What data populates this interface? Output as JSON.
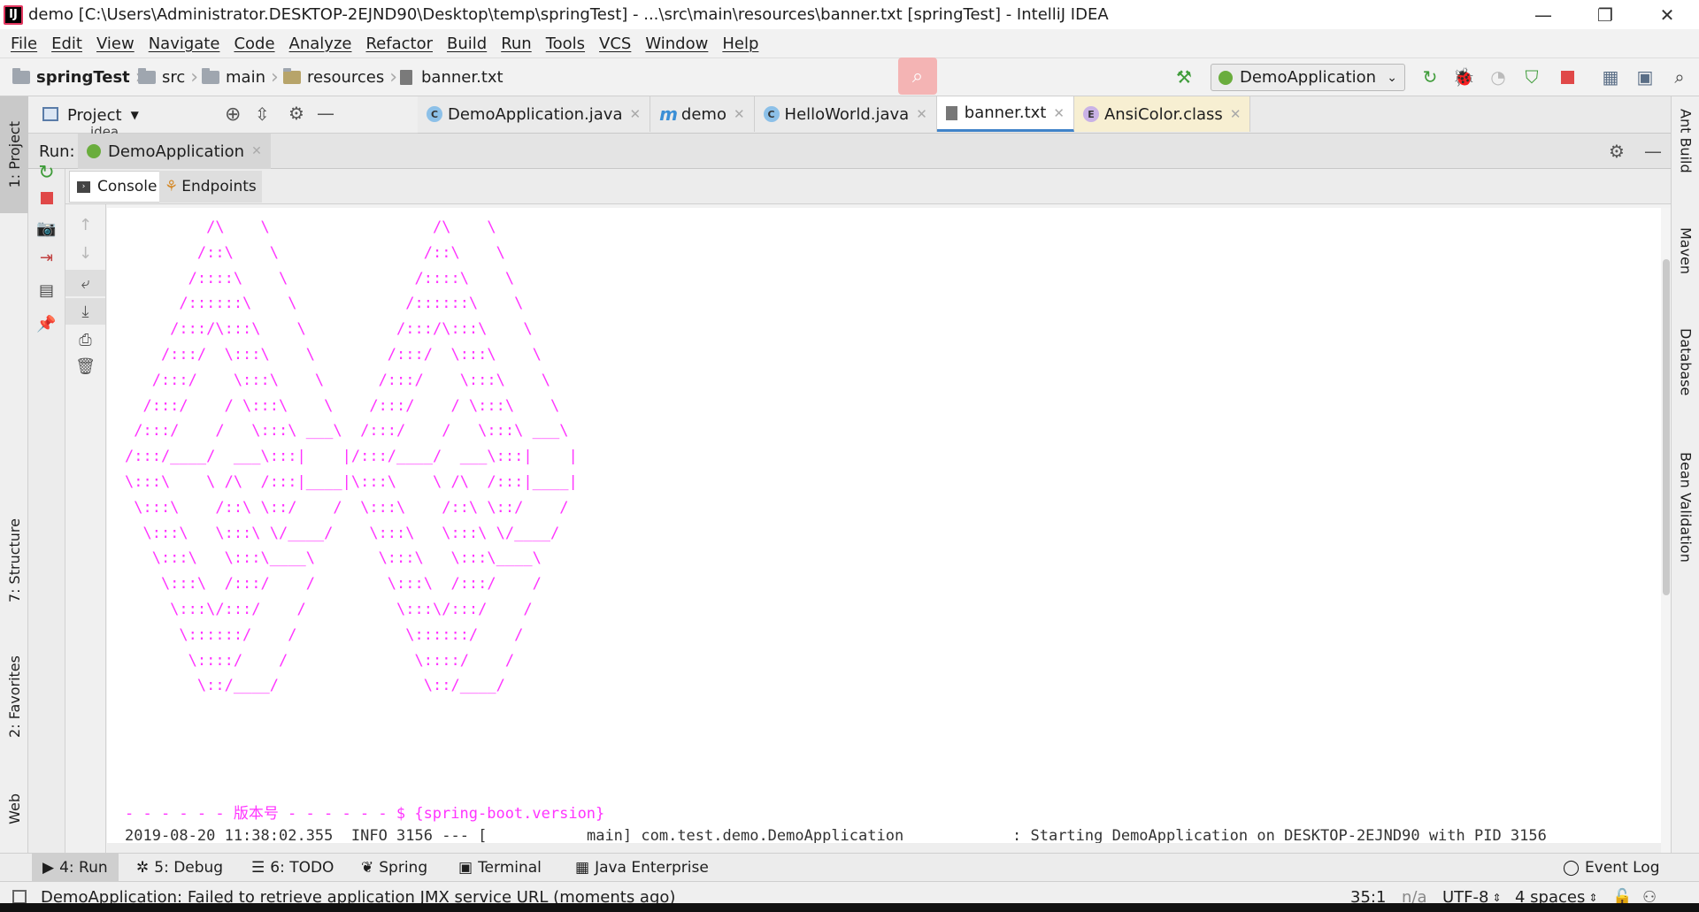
{
  "window": {
    "title": "demo [C:\\Users\\Administrator.DESKTOP-2EJND90\\Desktop\\temp\\springTest] - ...\\src\\main\\resources\\banner.txt [springTest] - IntelliJ IDEA",
    "app_icon": "IJ",
    "minimize": "—",
    "restore": "❐",
    "close": "✕"
  },
  "menu": [
    "File",
    "Edit",
    "View",
    "Navigate",
    "Code",
    "Analyze",
    "Refactor",
    "Build",
    "Run",
    "Tools",
    "VCS",
    "Window",
    "Help"
  ],
  "breadcrumbs": [
    "springTest",
    "src",
    "main",
    "resources",
    "banner.txt"
  ],
  "run_config": "DemoApplication",
  "project_panel": {
    "label": "Project",
    "hidden_item": "idea"
  },
  "editor_tabs": [
    {
      "label": "DemoApplication.java",
      "icon": "C",
      "color": "#3b8fd6"
    },
    {
      "label": "demo",
      "icon": "m",
      "color": "#3b8fd6"
    },
    {
      "label": "HelloWorld.java",
      "icon": "C",
      "color": "#3b8fd6"
    },
    {
      "label": "banner.txt",
      "icon": "txt",
      "color": "#777777"
    },
    {
      "label": "AnsiColor.class",
      "icon": "E",
      "color": "#b38bd6"
    }
  ],
  "run": {
    "label": "Run:",
    "tab": "DemoApplication",
    "console_tab": "Console",
    "endpoints_tab": "Endpoints"
  },
  "console": {
    "banner": "         /\\    \\                  /\\    \\\n        /::\\    \\                /::\\    \\\n       /::::\\    \\              /::::\\    \\\n      /::::::\\    \\            /::::::\\    \\\n     /:::/\\:::\\    \\          /:::/\\:::\\    \\\n    /:::/  \\:::\\    \\        /:::/  \\:::\\    \\\n   /:::/    \\:::\\    \\      /:::/    \\:::\\    \\\n  /:::/    / \\:::\\    \\    /:::/    / \\:::\\    \\\n /:::/    /   \\:::\\ ___\\  /:::/    /   \\:::\\ ___\\\n/:::/____/  ___\\:::|    |/:::/____/  ___\\:::|    |\n\\:::\\    \\ /\\  /:::|____|\\:::\\    \\ /\\  /:::|____|\n \\:::\\    /::\\ \\::/    /  \\:::\\    /::\\ \\::/    /\n  \\:::\\   \\:::\\ \\/____/    \\:::\\   \\:::\\ \\/____/\n   \\:::\\   \\:::\\____\\       \\:::\\   \\:::\\____\\\n    \\:::\\  /:::/    /        \\:::\\  /:::/    /\n     \\:::\\/:::/    /          \\:::\\/:::/    /\n      \\::::::/    /            \\::::::/    /\n       \\::::/    /              \\::::/    /\n        \\::/____/                \\::/____/",
    "version_line": "- - - - - - 版本号 - - - - - - $ {spring-boot.version}",
    "log_line": "2019-08-20 11:38:02.355  INFO 3156 --- [           main] com.test.demo.DemoApplication            : Starting DemoApplication on DESKTOP-2EJND90 with PID 3156"
  },
  "left_tool_tabs": [
    "1: Project",
    "7: Structure",
    "2: Favorites",
    "Web"
  ],
  "right_tool_tabs": [
    "Ant Build",
    "Maven",
    "Database",
    "Bean Validation"
  ],
  "bottom_tabs": [
    "4: Run",
    "5: Debug",
    "6: TODO",
    "Spring",
    "Terminal",
    "Java Enterprise",
    "Event Log"
  ],
  "status": {
    "message": "DemoApplication: Failed to retrieve application JMX service URL (moments ago)",
    "position": "35:1",
    "na": "n/a",
    "encoding": "UTF-8",
    "indent": "4 spaces"
  },
  "colors": {
    "banner": "#ff33ff",
    "accent": "#4083c9",
    "stop": "#e04848",
    "run_green": "#3f9c3a"
  }
}
